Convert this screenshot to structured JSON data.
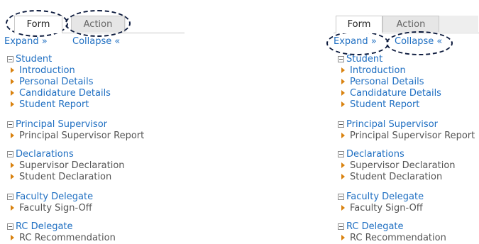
{
  "tabs": {
    "form": "Form",
    "action": "Action"
  },
  "links": {
    "expand": "Expand »",
    "collapse": "Collapse «"
  },
  "sections": [
    {
      "title": "Student",
      "items": [
        {
          "label": "Introduction",
          "style": "link"
        },
        {
          "label": "Personal Details",
          "style": "link"
        },
        {
          "label": "Candidature Details",
          "style": "link"
        },
        {
          "label": "Student Report",
          "style": "link"
        }
      ]
    },
    {
      "title": "Principal Supervisor",
      "items": [
        {
          "label": "Principal Supervisor Report",
          "style": "plain"
        }
      ]
    },
    {
      "title": "Declarations",
      "items": [
        {
          "label": "Supervisor Declaration",
          "style": "plain"
        },
        {
          "label": "Student Declaration",
          "style": "plain"
        }
      ]
    },
    {
      "title": "Faculty Delegate",
      "items": [
        {
          "label": "Faculty Sign-Off",
          "style": "plain"
        }
      ]
    },
    {
      "title": "RC Delegate",
      "items": [
        {
          "label": "RC Recommendation",
          "style": "plain"
        }
      ]
    }
  ],
  "colors": {
    "link": "#1f6fc2",
    "marker": "#d9820f",
    "annotation": "#0d1b3e"
  }
}
